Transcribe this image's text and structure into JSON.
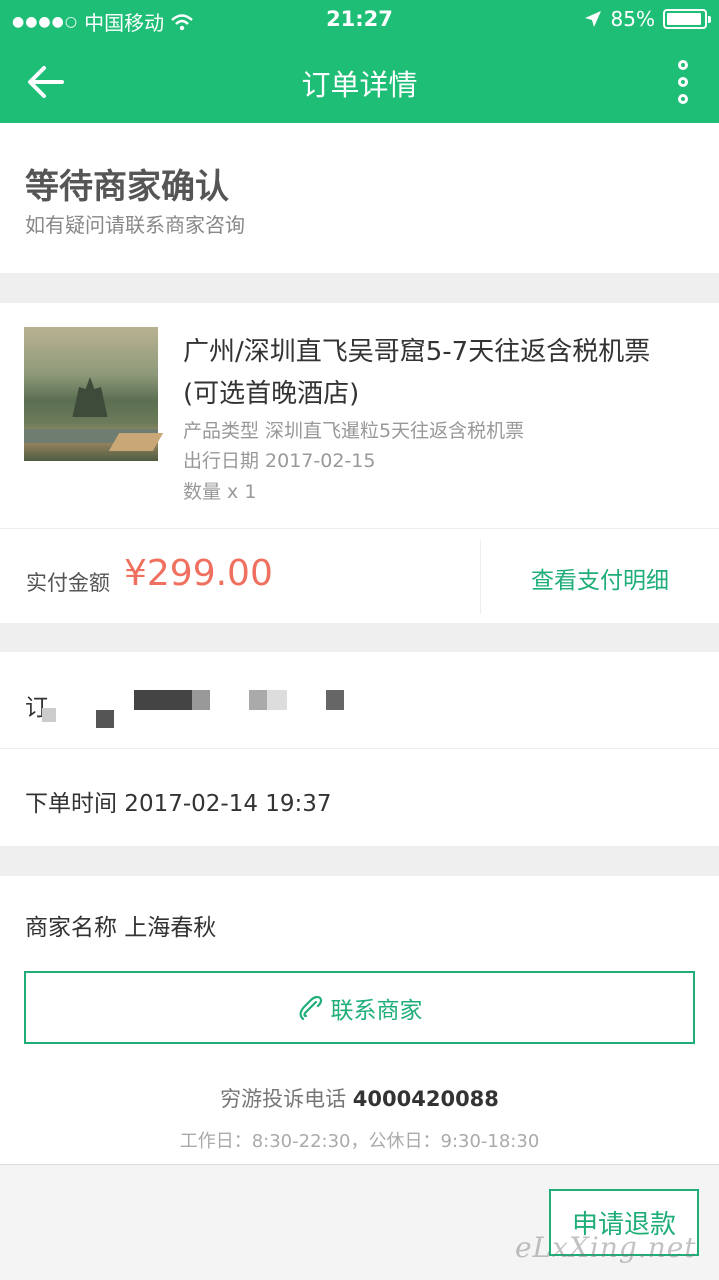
{
  "status_bar": {
    "signal": "●●●●○",
    "carrier": "中国移动",
    "time": "21:27",
    "battery": "85%"
  },
  "header": {
    "title": "订单详情"
  },
  "order_status": {
    "title": "等待商家确认",
    "subtitle": "如有疑问请联系商家咨询"
  },
  "product": {
    "title": "广州/深圳直飞吴哥窟5-7天往返含税机票(可选首晚酒店)",
    "type": "产品类型 深圳直飞暹粒5天往返含税机票",
    "date": "出行日期 2017-02-15",
    "quantity": "数量 x 1"
  },
  "payment": {
    "label": "实付金额",
    "amount": "¥299.00",
    "detail_link": "查看支付明细"
  },
  "order": {
    "number_label": "订",
    "time": "下单时间 2017-02-14 19:37"
  },
  "merchant": {
    "name": "商家名称 上海春秋",
    "contact_button": "联系商家",
    "hotline_label": "穷游投诉电话",
    "hotline_number": "4000420088",
    "hours": "工作日：8:30-22:30，公休日：9:30-18:30"
  },
  "footer": {
    "refund_button": "申请退款",
    "watermark": "eLxXing.net"
  },
  "colors": {
    "brand": "#1fbe77",
    "price": "#f07060"
  }
}
